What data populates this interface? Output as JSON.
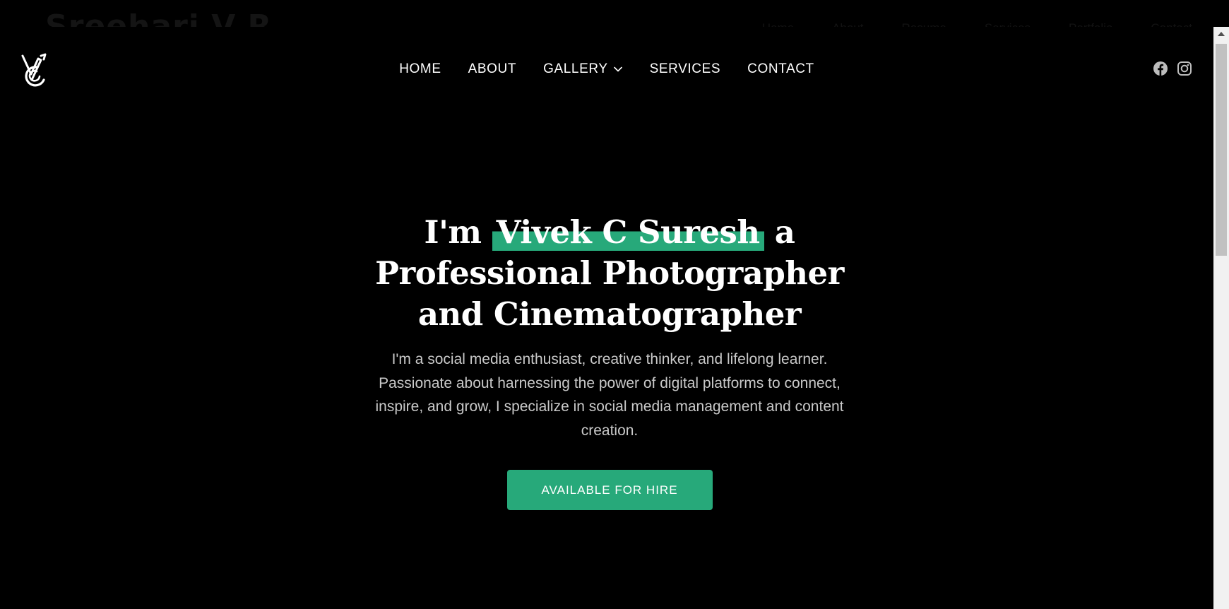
{
  "background_header": {
    "title": "Sreehari V R",
    "nav": [
      "Home",
      "About",
      "Resume",
      "Services",
      "Portfolio",
      "Contact"
    ]
  },
  "header": {
    "logo": "vc-monogram-logo",
    "nav": [
      {
        "label": "HOME"
      },
      {
        "label": "ABOUT"
      },
      {
        "label": "GALLERY",
        "has_dropdown": true
      },
      {
        "label": "SERVICES"
      },
      {
        "label": "CONTACT"
      }
    ],
    "social": [
      "facebook-icon",
      "instagram-icon"
    ]
  },
  "hero": {
    "heading_prefix": "I'm",
    "heading_name": "Vivek C Suresh",
    "heading_suffix": "a Professional Photographer and Cinematographer",
    "description": "I'm a social media enthusiast, creative thinker, and lifelong learner. Passionate about harnessing the power of digital platforms to connect, inspire, and grow, I specialize in social media management and content creation.",
    "cta_label": "AVAILABLE FOR HIRE"
  },
  "colors": {
    "accent": "#27a97a",
    "background": "#000000",
    "text": "#ffffff",
    "muted_text": "#c9c9c9"
  }
}
